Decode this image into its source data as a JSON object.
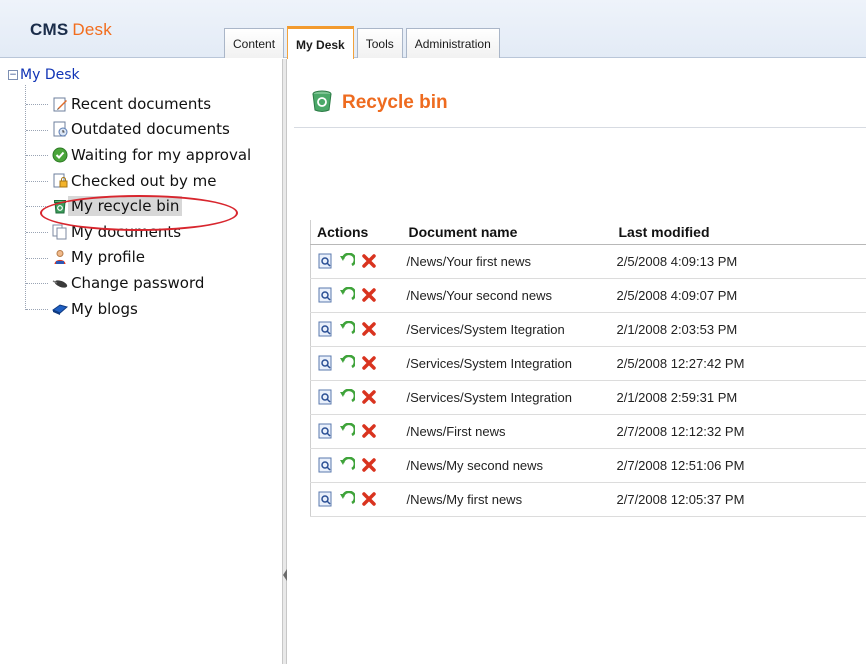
{
  "app": {
    "logo_cms": "CMS",
    "logo_desk": "Desk"
  },
  "tabs": [
    {
      "label": "Content"
    },
    {
      "label": "My Desk",
      "active": true
    },
    {
      "label": "Tools"
    },
    {
      "label": "Administration"
    }
  ],
  "tree": {
    "root_label": "My Desk",
    "items": [
      {
        "label": "Recent documents",
        "icon": "recent-documents-icon"
      },
      {
        "label": "Outdated documents",
        "icon": "outdated-documents-icon"
      },
      {
        "label": "Waiting for my approval",
        "icon": "approval-icon"
      },
      {
        "label": "Checked out by me",
        "icon": "checked-out-icon"
      },
      {
        "label": "My recycle bin",
        "icon": "recycle-bin-icon",
        "selected": true
      },
      {
        "label": "My documents",
        "icon": "my-documents-icon"
      },
      {
        "label": "My profile",
        "icon": "profile-icon"
      },
      {
        "label": "Change password",
        "icon": "password-icon"
      },
      {
        "label": "My blogs",
        "icon": "blogs-icon"
      }
    ]
  },
  "main": {
    "title": "Recycle bin",
    "columns": [
      "Actions",
      "Document name",
      "Last modified"
    ],
    "rows": [
      {
        "name": "/News/Your first news",
        "modified": "2/5/2008 4:09:13 PM"
      },
      {
        "name": "/News/Your second news",
        "modified": "2/5/2008 4:09:07 PM"
      },
      {
        "name": "/Services/System Itegration",
        "modified": "2/1/2008 2:03:53 PM"
      },
      {
        "name": "/Services/System Integration",
        "modified": "2/5/2008 12:27:42 PM"
      },
      {
        "name": "/Services/System Integration",
        "modified": "2/1/2008 2:59:31 PM"
      },
      {
        "name": "/News/First news",
        "modified": "2/7/2008 12:12:32 PM"
      },
      {
        "name": "/News/My second news",
        "modified": "2/7/2008 12:51:06 PM"
      },
      {
        "name": "/News/My first news",
        "modified": "2/7/2008 12:05:37 PM"
      }
    ]
  },
  "colors": {
    "accent": "#ee6b1f",
    "tab_active": "#f29a2e",
    "highlight": "#d8262e",
    "link": "#1033b5"
  }
}
